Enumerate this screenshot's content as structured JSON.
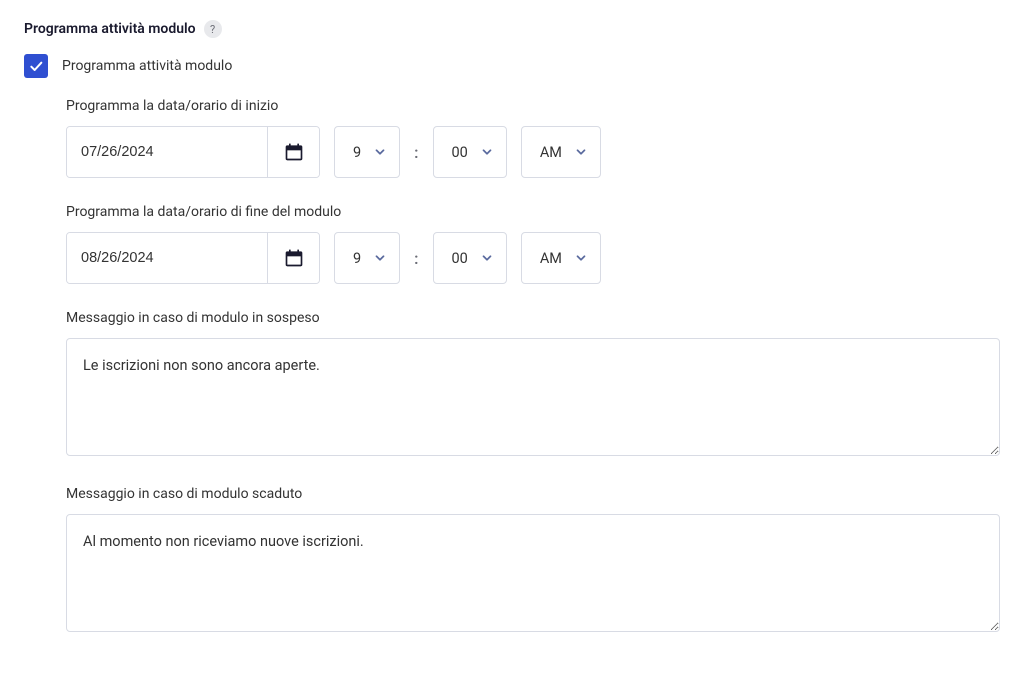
{
  "section": {
    "title": "Programma attività modulo",
    "help_symbol": "?"
  },
  "checkbox": {
    "label": "Programma attività modulo",
    "checked": true
  },
  "start": {
    "label": "Programma la data/orario di inizio",
    "date": "07/26/2024",
    "hour": "9",
    "minute": "00",
    "ampm": "AM"
  },
  "end": {
    "label": "Programma la data/orario di fine del modulo",
    "date": "08/26/2024",
    "hour": "9",
    "minute": "00",
    "ampm": "AM"
  },
  "pending": {
    "label": "Messaggio in caso di modulo in sospeso",
    "value": "Le iscrizioni non sono ancora aperte."
  },
  "expired": {
    "label": "Messaggio in caso di modulo scaduto",
    "value": "Al momento non riceviamo nuove iscrizioni."
  },
  "separator": ":"
}
